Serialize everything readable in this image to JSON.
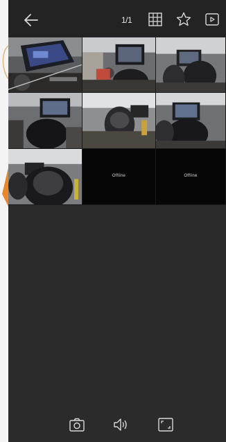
{
  "topbar": {
    "page_indicator": "1/1",
    "icons": [
      "back-arrow-icon",
      "grid-layout-icon",
      "star-icon",
      "playback-icon"
    ]
  },
  "grid": {
    "cells": [
      {
        "type": "camera-feed",
        "scene": "monitor-over-desk"
      },
      {
        "type": "camera-feed",
        "scene": "monitor-with-operator"
      },
      {
        "type": "camera-feed",
        "scene": "operator-at-desk"
      },
      {
        "type": "camera-feed",
        "scene": "monitor-with-helmet"
      },
      {
        "type": "camera-feed",
        "scene": "helmet-rear-view"
      },
      {
        "type": "camera-feed",
        "scene": "helmet-rear-view"
      },
      {
        "type": "camera-feed",
        "scene": "helmet-close-up"
      },
      {
        "type": "offline",
        "label": "Offline"
      },
      {
        "type": "offline",
        "label": "Offline"
      }
    ]
  },
  "bottombar": {
    "icons": [
      "camera-snapshot-icon",
      "speaker-icon",
      "fullscreen-icon"
    ]
  },
  "colors": {
    "background": "#2b2b2b",
    "topbar": "#232323",
    "icon": "#d9d9d9",
    "accent_marker": "#e8882a"
  }
}
